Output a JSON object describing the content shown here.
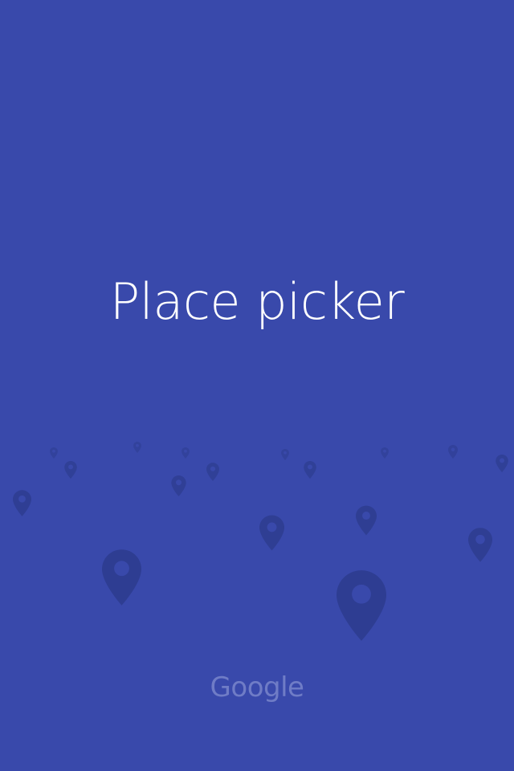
{
  "app": {
    "title": "Place picker",
    "brand": "Google"
  },
  "icons": {
    "pin": "map-pin-icon"
  },
  "colors": {
    "background": "#3949AB",
    "title": "#FFFFFF",
    "pin": "#2E3D91",
    "brand": "#6F7CC6"
  }
}
